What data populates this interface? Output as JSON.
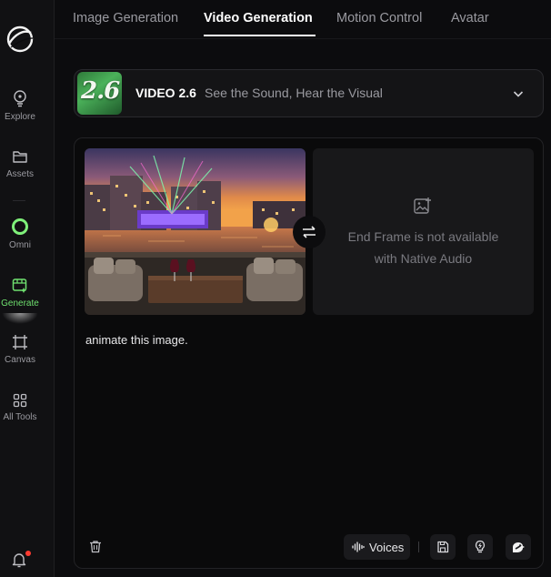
{
  "sidebar": {
    "items": [
      {
        "label": "Explore",
        "icon": "bulb-icon"
      },
      {
        "label": "Assets",
        "icon": "folder-icon"
      },
      {
        "label": "Omni",
        "icon": "omni-ring-icon"
      },
      {
        "label": "Generate",
        "icon": "generate-icon",
        "active": true
      },
      {
        "label": "Canvas",
        "icon": "canvas-frame-icon"
      },
      {
        "label": "All Tools",
        "icon": "grid-icon"
      }
    ],
    "accent_color": "#6fe06f",
    "notification_dot_color": "#ff3b30"
  },
  "tabs": [
    {
      "label": "Image Generation"
    },
    {
      "label": "Video Generation",
      "active": true
    },
    {
      "label": "Motion Control"
    },
    {
      "label": "Avatar"
    }
  ],
  "model": {
    "thumb_text": "2.6",
    "name": "VIDEO 2.6",
    "tagline": "See the Sound, Hear the Visual"
  },
  "frames": {
    "end_frame_line1": "End Frame is not available",
    "end_frame_line2": "with Native Audio"
  },
  "prompt": {
    "text": "animate this image."
  },
  "toolbar": {
    "voices_label": "Voices"
  }
}
